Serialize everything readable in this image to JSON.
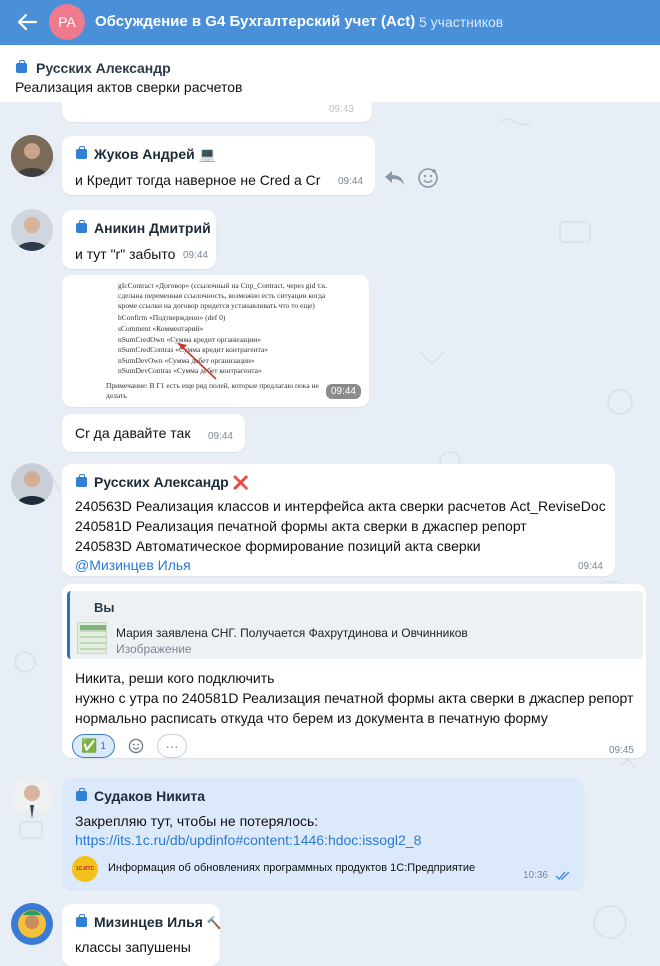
{
  "header": {
    "avatar_initials": "РА",
    "title": "Обсуждение в G4 Бухгалтерский учет (Act)",
    "members": "5 участников",
    "back_icon": "arrow-left-icon",
    "color": "#4a90d9"
  },
  "pinned": {
    "author": "Русских Александр",
    "text": "Реализация актов сверки расчетов",
    "peek_time": "09:43"
  },
  "messages": [
    {
      "author": "Жуков Андрей",
      "badge": "💻",
      "text": "и Кредит тогда наверное не Cred а Cr",
      "time": "09:44"
    },
    {
      "author": "Аникин Дмитрий",
      "text": "и тут \"r\" забыто",
      "time": "09:44"
    },
    {
      "image_time": "09:44",
      "image_lines": [
        "gIcContract «Договор» (ссылочный на Спр_Contract, через gid т.к.",
        "сделана переменная ссылочность, возможно есть ситуации когда",
        "кроме ссылки на договор придется устанавливать что то еще)",
        "bConfirm «Подтверждено» (def 0)",
        "sComment «Комментарий»",
        "nSumCredOwn «Сумма кредит организации»",
        "nSumCredContras «Сумма кредит контрагента»",
        "nSumDevOwn «Сумма дебет организации»",
        "nSumDevContras «Сумма дебет контрагента»",
        "Примечание: В Г1 есть еще ряд полей, которые предлагаю пока не",
        "делать"
      ]
    },
    {
      "text": "Cr да давайте так",
      "time": "09:44"
    },
    {
      "author": "Русских Александр",
      "badge": "❌",
      "lines": [
        "240563D Реализация классов и интерфейса акта сверки расчетов Act_ReviseDoc",
        "240581D  Реализация печатной формы акта сверки в джаспер репорт",
        "240583D  Автоматическое формирование позиций акта сверки"
      ],
      "mention": "@Мизинцев Илья",
      "time": "09:44"
    },
    {
      "reply_author": "Вы",
      "reply_text": "Мария заявлена СНГ. Получается Фахрутдинова и Овчинников",
      "reply_kind": "Изображение",
      "lines": [
        "Никита, реши кого подключить",
        "нужно с утра по 240581D  Реализация печатной формы акта сверки в джаспер репорт",
        "нормально расписать откуда что берем из документа в печатную форму"
      ],
      "reaction": "✅",
      "reaction_count": "1",
      "more": "···",
      "time": "09:45"
    },
    {
      "author": "Судаков Никита",
      "text": "Закрепляю тут, чтобы не потерялось:",
      "link": "https://its.1c.ru/db/updinfo#content:1446:hdoc:issogl2_8",
      "preview_title": "Информация об обновлениях программных продуктов 1С:Предприятие",
      "preview_logo": "1С:ИТС",
      "time": "10:36"
    },
    {
      "author": "Мизинцев Илья",
      "badge": "🔨",
      "text": "классы запушены"
    }
  ]
}
